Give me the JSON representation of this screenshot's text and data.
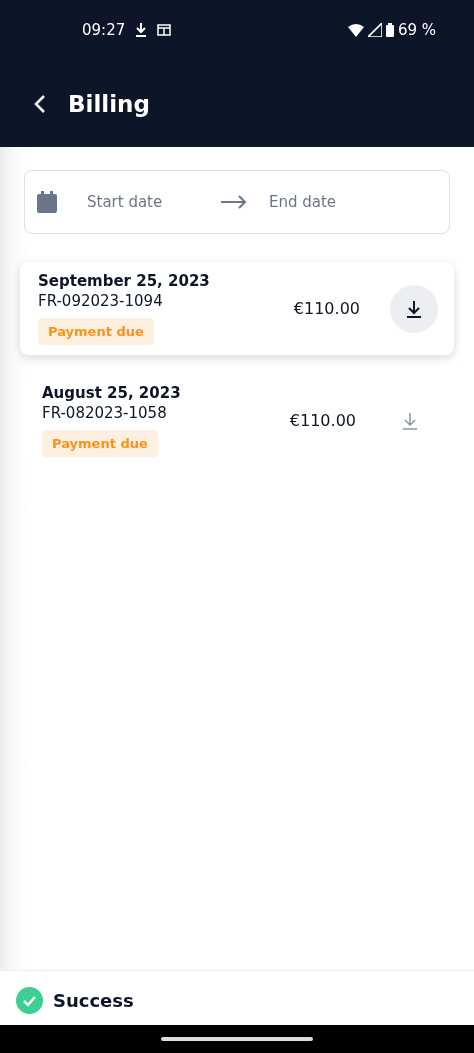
{
  "status_bar": {
    "time": "09:27",
    "battery": "69 %"
  },
  "app_bar": {
    "title": "Billing"
  },
  "date_range": {
    "start_placeholder": "Start date",
    "end_placeholder": "End date"
  },
  "invoices": [
    {
      "date": "September 25, 2023",
      "number": "FR-092023-1094",
      "status": "Payment due",
      "amount": "€110.00",
      "selected": true
    },
    {
      "date": "August 25, 2023",
      "number": "FR-082023-1058",
      "status": "Payment due",
      "amount": "€110.00",
      "selected": false
    }
  ],
  "toast": {
    "title": "Success"
  }
}
